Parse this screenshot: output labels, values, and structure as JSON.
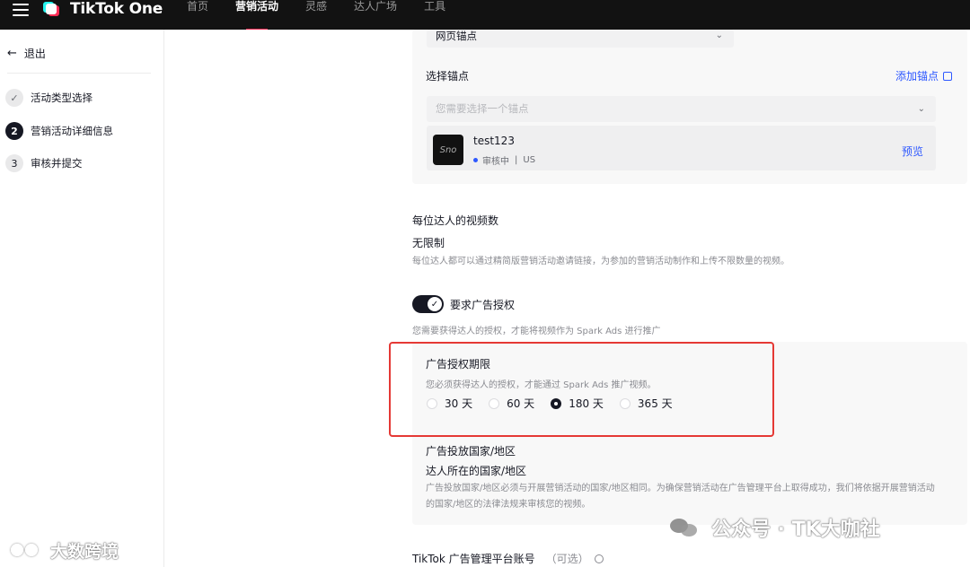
{
  "topbar": {
    "brand": "TikTok One",
    "nav": [
      {
        "label": "首页",
        "active": false
      },
      {
        "label": "营销活动",
        "active": true
      },
      {
        "label": "灵感",
        "active": false
      },
      {
        "label": "达人广场",
        "active": false
      },
      {
        "label": "工具",
        "active": false
      }
    ]
  },
  "sidebar": {
    "back_label": "退出",
    "steps": [
      {
        "index": "✓",
        "label": "活动类型选择",
        "state": "done"
      },
      {
        "index": "2",
        "label": "营销活动详细信息",
        "state": "current"
      },
      {
        "index": "3",
        "label": "审核并提交",
        "state": "pending"
      }
    ]
  },
  "anchor": {
    "type_select_value": "网页锚点",
    "select_label": "选择锚点",
    "add_link": "添加锚点",
    "select_placeholder": "您需要选择一个锚点",
    "item": {
      "thumb_text": "Sno",
      "name": "test123",
      "status": "审核中",
      "region": "US",
      "preview": "预览"
    }
  },
  "videos_per_creator": {
    "title": "每位达人的视频数",
    "value": "无限制",
    "desc": "每位达人都可以通过精简版营销活动邀请链接，为参加的营销活动制作和上传不限数量的视频。"
  },
  "ad_auth": {
    "toggle_label": "要求广告授权",
    "toggle_on": true,
    "desc": "您需要获得达人的授权，才能将视频作为 Spark Ads 进行推广",
    "period_title": "广告授权期限",
    "period_desc": "您必须获得达人的授权，才能通过 Spark Ads 推广视频。",
    "options": [
      {
        "label": "30 天",
        "selected": false
      },
      {
        "label": "60 天",
        "selected": false
      },
      {
        "label": "180 天",
        "selected": true
      },
      {
        "label": "365 天",
        "selected": false
      }
    ]
  },
  "ad_region": {
    "title": "广告投放国家/地区",
    "value": "达人所在的国家/地区",
    "desc_line1": "广告投放国家/地区必须与开展营销活动的国家/地区相同。为确保营销活动在广告管理平台上取得成功，我们将依据开展营销活动",
    "desc_line2": "的国家/地区的法律法规来审核您的视频。"
  },
  "tiktok_ads": {
    "label": "TikTok 广告管理平台账号",
    "optional": "（可选）"
  },
  "watermarks": {
    "right": "公众号 · TK大咖社",
    "left": "大数跨境"
  },
  "colors": {
    "topbar": "#121212",
    "accent_blue": "#2e58ff",
    "nav_underline": "#FE2C55",
    "highlight_red": "#e53935"
  }
}
